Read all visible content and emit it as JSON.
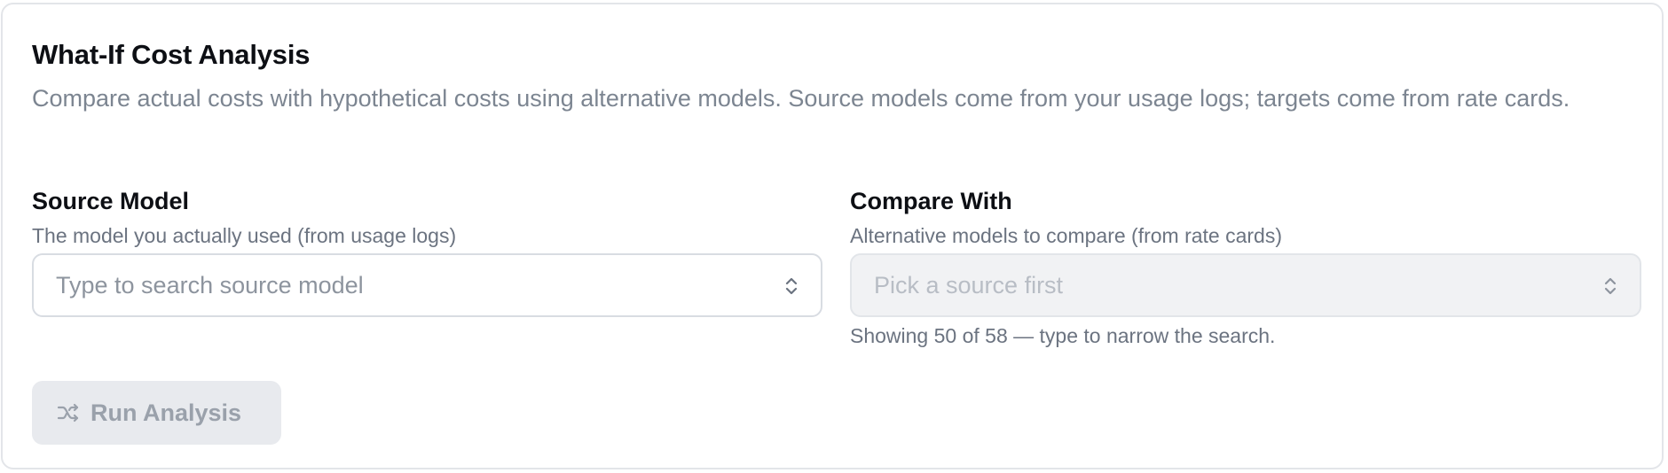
{
  "header": {
    "title": "What-If Cost Analysis",
    "description": "Compare actual costs with hypothetical costs using alternative models. Source models come from your usage logs; targets come from rate cards."
  },
  "source": {
    "label": "Source Model",
    "help": "The model you actually used (from usage logs)",
    "placeholder": "Type to search source model",
    "icon": "chevron-up-down-icon"
  },
  "compare": {
    "label": "Compare With",
    "help": "Alternative models to compare (from rate cards)",
    "placeholder": "Pick a source first",
    "icon": "chevron-up-down-icon",
    "disabled": true,
    "note": "Showing 50 of 58 — type to narrow the search."
  },
  "actions": {
    "run_label": "Run Analysis",
    "run_icon": "shuffle-icon",
    "run_disabled": true
  },
  "colors": {
    "border": "#e3e5e9",
    "text_primary": "#0d0f14",
    "text_muted": "#7c8591",
    "disabled_bg": "#e8eaee"
  }
}
